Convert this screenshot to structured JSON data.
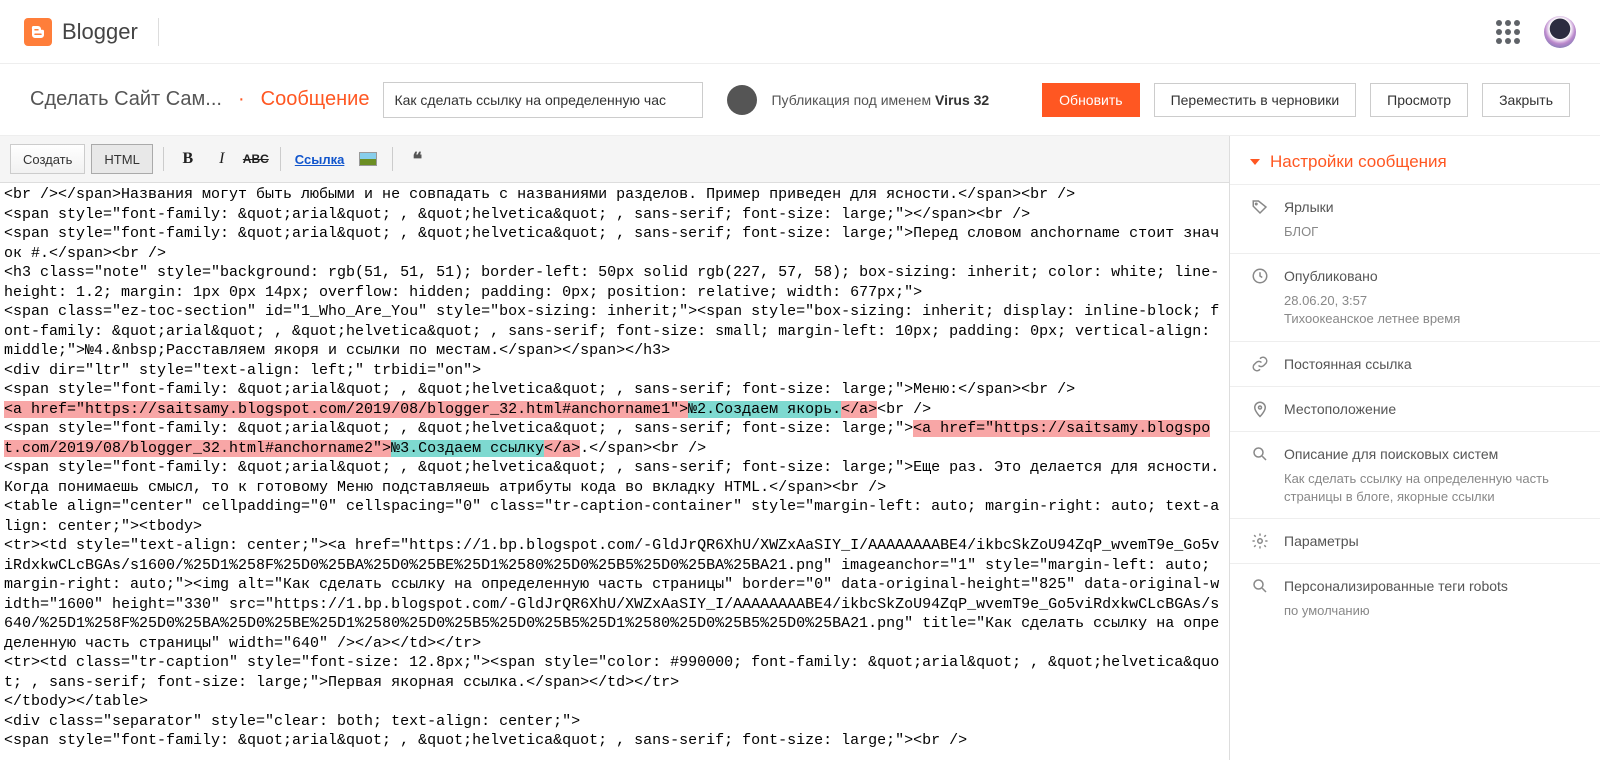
{
  "topbar": {
    "app_name": "Blogger"
  },
  "actionbar": {
    "blog_title": "Сделать Сайт Сам...",
    "page_label": "Сообщение",
    "post_title": "Как сделать ссылку на определенную час",
    "publish_as_prefix": "Публикация под именем ",
    "publish_as_name": "Virus 32",
    "update_btn": "Обновить",
    "drafts_btn": "Переместить в черновики",
    "preview_btn": "Просмотр",
    "close_btn": "Закрыть"
  },
  "toolbar": {
    "compose": "Создать",
    "html": "HTML",
    "bold_glyph": "B",
    "italic_glyph": "I",
    "strike_glyph": "ABC",
    "link_label": "Ссылка",
    "quote_glyph": "❝"
  },
  "code": {
    "line1": "<br /></span>Названия могут быть любыми и не совпадать с названиями разделов. Пример приведен для ясности.</span><br />",
    "line2": "<span style=\"font-family: &quot;arial&quot; , &quot;helvetica&quot; , sans-serif; font-size: large;\"></span><br />",
    "line3": "<span style=\"font-family: &quot;arial&quot; , &quot;helvetica&quot; , sans-serif; font-size: large;\">Перед словом anchorname стоит значок #.</span><br />",
    "line4": "<h3 class=\"note\" style=\"background: rgb(51, 51, 51); border-left: 50px solid rgb(227, 57, 58); box-sizing: inherit; color: white; line-height: 1.2; margin: 1px 0px 14px; overflow: hidden; padding: 0px; position: relative; width: 677px;\">",
    "line5": "<span class=\"ez-toc-section\" id=\"1_Who_Are_You\" style=\"box-sizing: inherit;\"><span style=\"box-sizing: inherit; display: inline-block; font-family: &quot;arial&quot; , &quot;helvetica&quot; , sans-serif; font-size: small; margin-left: 10px; padding: 0px; vertical-align: middle;\">№4.&nbsp;Расставляем якоря и ссылки по местам.</span></span></h3>",
    "line6": "<div dir=\"ltr\" style=\"text-align: left;\" trbidi=\"on\">",
    "line7": "<span style=\"font-family: &quot;arial&quot; , &quot;helvetica&quot; , sans-serif; font-size: large;\">Меню:</span><br />",
    "anchor1_open": "<a href=\"https://saitsamy.blogspot.com/2019/08/blogger_32.html#anchorname1\">",
    "anchor1_text": "№2.Создаем якорь.",
    "anchor1_close": "</a>",
    "after_anchor1": "<br />",
    "span_open2": "<span style=\"font-family: &quot;arial&quot; , &quot;helvetica&quot; , sans-serif; font-size: large;\">",
    "anchor2_open": "<a href=\"https://saitsamy.blogspot.com/2019/08/blogger_32.html#anchorname2\">",
    "anchor2_text": "№3.Создаем ссылку",
    "anchor2_close": "</a>",
    "after_anchor2": ".</span><br />",
    "line8": "<span style=\"font-family: &quot;arial&quot; , &quot;helvetica&quot; , sans-serif; font-size: large;\">Еще раз. Это делается для ясности. Когда понимаешь смысл, то к готовому Меню подставляешь атрибуты кода во вкладку HTML.</span><br />",
    "line9": "<table align=\"center\" cellpadding=\"0\" cellspacing=\"0\" class=\"tr-caption-container\" style=\"margin-left: auto; margin-right: auto; text-align: center;\"><tbody>",
    "line10": "<tr><td style=\"text-align: center;\"><a href=\"https://1.bp.blogspot.com/-GldJrQR6XhU/XWZxAaSIY_I/AAAAAAAABE4/ikbcSkZoU94ZqP_wvemT9e_Go5viRdxkwCLcBGAs/s1600/%25D1%258F%25D0%25BA%25D0%25BE%25D1%2580%25D0%25B5%25D0%25BA%25BA21.png\" imageanchor=\"1\" style=\"margin-left: auto; margin-right: auto;\"><img alt=\"Как сделать ссылку на определенную часть страницы\" border=\"0\" data-original-height=\"825\" data-original-width=\"1600\" height=\"330\" src=\"https://1.bp.blogspot.com/-GldJrQR6XhU/XWZxAaSIY_I/AAAAAAAABE4/ikbcSkZoU94ZqP_wvemT9e_Go5viRdxkwCLcBGAs/s640/%25D1%258F%25D0%25BA%25D0%25BE%25D1%2580%25D0%25B5%25D0%25B5%25D1%2580%25D0%25B5%25D0%25BA21.png\" title=\"Как сделать ссылку на определенную часть страницы\" width=\"640\" /></a></td></tr>",
    "line11": "<tr><td class=\"tr-caption\" style=\"font-size: 12.8px;\"><span style=\"color: #990000; font-family: &quot;arial&quot; , &quot;helvetica&quot; , sans-serif; font-size: large;\">Первая якорная ссылка.</span></td></tr>",
    "line12": "</tbody></table>",
    "line13": "<div class=\"separator\" style=\"clear: both; text-align: center;\">",
    "line14": "<span style=\"font-family: &quot;arial&quot; , &quot;helvetica&quot; , sans-serif; font-size: large;\"><br />"
  },
  "settings": {
    "header": "Настройки сообщения",
    "labels": {
      "title": "Ярлыки",
      "value": "БЛОГ"
    },
    "published": {
      "title": "Опубликовано",
      "date": "28.06.20, 3:57",
      "tz": "Тихоокеанское летнее время"
    },
    "permalink": {
      "title": "Постоянная ссылка"
    },
    "location": {
      "title": "Местоположение"
    },
    "search_desc": {
      "title": "Описание для поисковых систем",
      "value": "Как сделать ссылку на определенную часть страницы в блоге, якорные ссылки"
    },
    "options": {
      "title": "Параметры"
    },
    "robots": {
      "title": "Персонализированные теги robots",
      "value": "по умолчанию"
    }
  }
}
